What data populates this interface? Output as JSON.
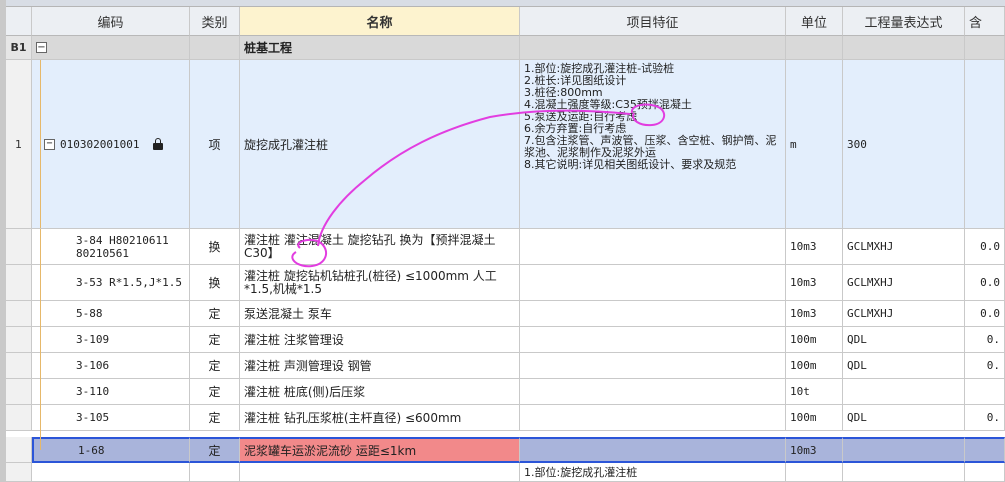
{
  "columns": {
    "code": "编码",
    "type": "类别",
    "name": "名称",
    "feature": "项目特征",
    "unit": "单位",
    "expr": "工程量表达式",
    "qty_partial": "含"
  },
  "section": {
    "rownum": "B1",
    "name": "桩基工程"
  },
  "main_item": {
    "rownum": "1",
    "code": "010302001001",
    "type": "项",
    "name": "旋挖成孔灌注桩",
    "features": [
      "1.部位:旋挖成孔灌注桩-试验桩",
      "2.桩长:详见图纸设计",
      "3.桩径:800mm",
      "4.混凝土强度等级:C35预拌混凝土",
      "5.泵送及运距:自行考虑",
      "6.余方弃置:自行考虑",
      "7.包含注浆管、声波管、压浆、含空桩、钢护筒、泥浆池、泥浆制作及泥浆外运",
      "8.其它说明:详见相关图纸设计、要求及规范"
    ],
    "unit": "m",
    "expr": "300"
  },
  "sub_items": [
    {
      "code": "3-84 H80210611 80210561",
      "type": "换",
      "name": "灌注桩 灌注混凝土 旋挖钻孔  换为【预拌混凝土 C30】",
      "unit": "10m3",
      "expr": "GCLMXHJ",
      "qty": "0.0"
    },
    {
      "code": "3-53 R*1.5,J*1.5",
      "type": "换",
      "name": "灌注桩 旋挖钻机钻桩孔(桩径) ≤1000mm 人工*1.5,机械*1.5",
      "unit": "10m3",
      "expr": "GCLMXHJ",
      "qty": "0.0"
    },
    {
      "code": "5-88",
      "type": "定",
      "name": "泵送混凝土 泵车",
      "unit": "10m3",
      "expr": "GCLMXHJ",
      "qty": "0.0"
    },
    {
      "code": "3-109",
      "type": "定",
      "name": "灌注桩 注浆管理设",
      "unit": "100m",
      "expr": "QDL",
      "qty": "0."
    },
    {
      "code": "3-106",
      "type": "定",
      "name": "灌注桩 声测管理设 钢管",
      "unit": "100m",
      "expr": "QDL",
      "qty": "0."
    },
    {
      "code": "3-110",
      "type": "定",
      "name": "灌注桩 桩底(侧)后压浆",
      "unit": "10t",
      "expr": "",
      "qty": ""
    },
    {
      "code": "3-105",
      "type": "定",
      "name": "灌注桩 钻孔压浆桩(主杆直径) ≤600mm",
      "unit": "100m",
      "expr": "QDL",
      "qty": "0."
    },
    {
      "code": "1-68",
      "type": "定",
      "name": "泥浆罐车运淤泥流砂 运距≤1km",
      "unit": "10m3",
      "expr": "",
      "qty": ""
    }
  ],
  "next_row_feature": "1.部位:旋挖成孔灌注桩",
  "colors": {
    "selected_name": "#f2898a",
    "selected_row": "#a9b4db",
    "selection_border": "#2b55d8",
    "annotation": "#e23de0"
  }
}
